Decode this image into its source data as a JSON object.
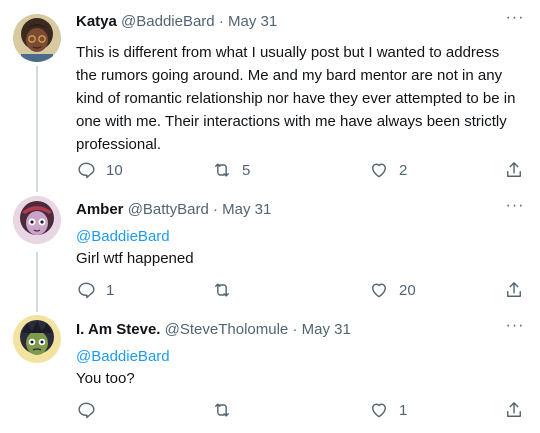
{
  "tweets": [
    {
      "name": "Katya",
      "handle": "@BaddieBard",
      "sep": "·",
      "date": "May 31",
      "mention": "",
      "text": "This is different from what I usually post but I wanted to address the rumors going around. Me and my bard mentor are not in any kind of romantic relationship nor have they ever attempted to be in one with me. Their interactions with me have always been strictly professional.",
      "replies": "10",
      "retweets": "5",
      "likes": "2"
    },
    {
      "name": "Amber",
      "handle": "@BattyBard",
      "sep": "·",
      "date": "May 31",
      "mention": "@BaddieBard",
      "text": "Girl wtf happened",
      "replies": "1",
      "retweets": "",
      "likes": "20"
    },
    {
      "name": "I. Am Steve.",
      "handle": "@SteveTholomule",
      "sep": "·",
      "date": "May 31",
      "mention": "@BaddieBard",
      "text": "You too?",
      "replies": "",
      "retweets": "",
      "likes": "1"
    }
  ],
  "more_glyph": "···",
  "colors": {
    "mention": "#1d9bf0",
    "secondary": "#536471",
    "thread_line": "#cfd9de"
  },
  "icons": [
    "reply-icon",
    "retweet-icon",
    "like-icon",
    "share-icon",
    "more-icon"
  ]
}
